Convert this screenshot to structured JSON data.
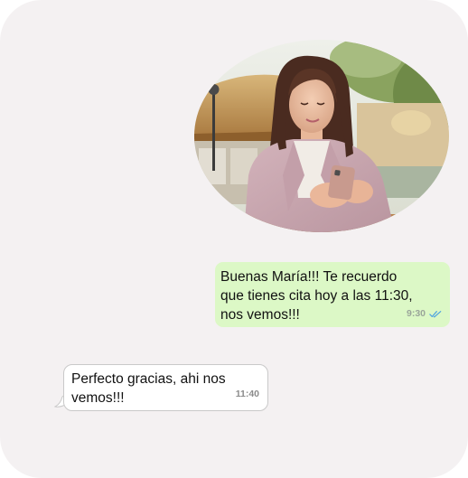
{
  "photo": {
    "icon": "woman-using-phone-photo"
  },
  "outgoing_message": {
    "text": "Buenas María!!! Te recuerdo\nque tienes cita hoy a las 11:30,\nnos vemos!!!",
    "time": "9:30",
    "status_icon": "double-check-read-icon",
    "bubble_color": "#dcf8c6",
    "tick_color": "#4fa3e0"
  },
  "incoming_message": {
    "text": "Perfecto gracias, ahi nos\nvemos!!!",
    "time": "11:40",
    "bubble_color": "#ffffff"
  },
  "background_color": "#f4f1f2"
}
